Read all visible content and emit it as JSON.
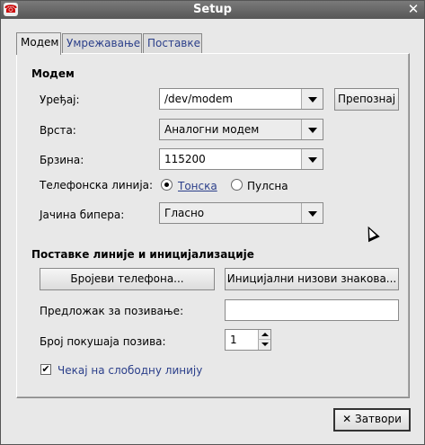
{
  "window": {
    "title": "Setup",
    "app_icon": "telephone-icon",
    "close_icon": "close-icon"
  },
  "tabs": [
    {
      "label": "Модем",
      "active": true
    },
    {
      "label": "Умрежавање",
      "active": false
    },
    {
      "label": "Поставке",
      "active": false
    }
  ],
  "modem": {
    "heading": "Модем",
    "device_label": "Уређај:",
    "device_value": "/dev/modem",
    "detect_button": "Препознај",
    "type_label": "Врста:",
    "type_value": "Аналогни модем",
    "speed_label": "Брзина:",
    "speed_value": "115200",
    "phone_line_label": "Телефонска линија:",
    "tone_label": "Тонска",
    "pulse_label": "Пулсна",
    "tone_selected": true,
    "volume_label": "Јачина бипера:",
    "volume_value": "Гласно"
  },
  "line": {
    "heading": "Поставке линије и иницијализације",
    "phone_numbers_button": "Бројеви телефона...",
    "init_strings_button": "Иницијални низови знакова...",
    "dial_prefix_label": "Предложак за позивање:",
    "dial_prefix_value": "",
    "retries_label": "Број покушаја позива:",
    "retries_value": "1",
    "wait_dialtone_label": "Чекај на слободну линију",
    "wait_dialtone_checked": true
  },
  "footer": {
    "close_button": "Затвори"
  }
}
